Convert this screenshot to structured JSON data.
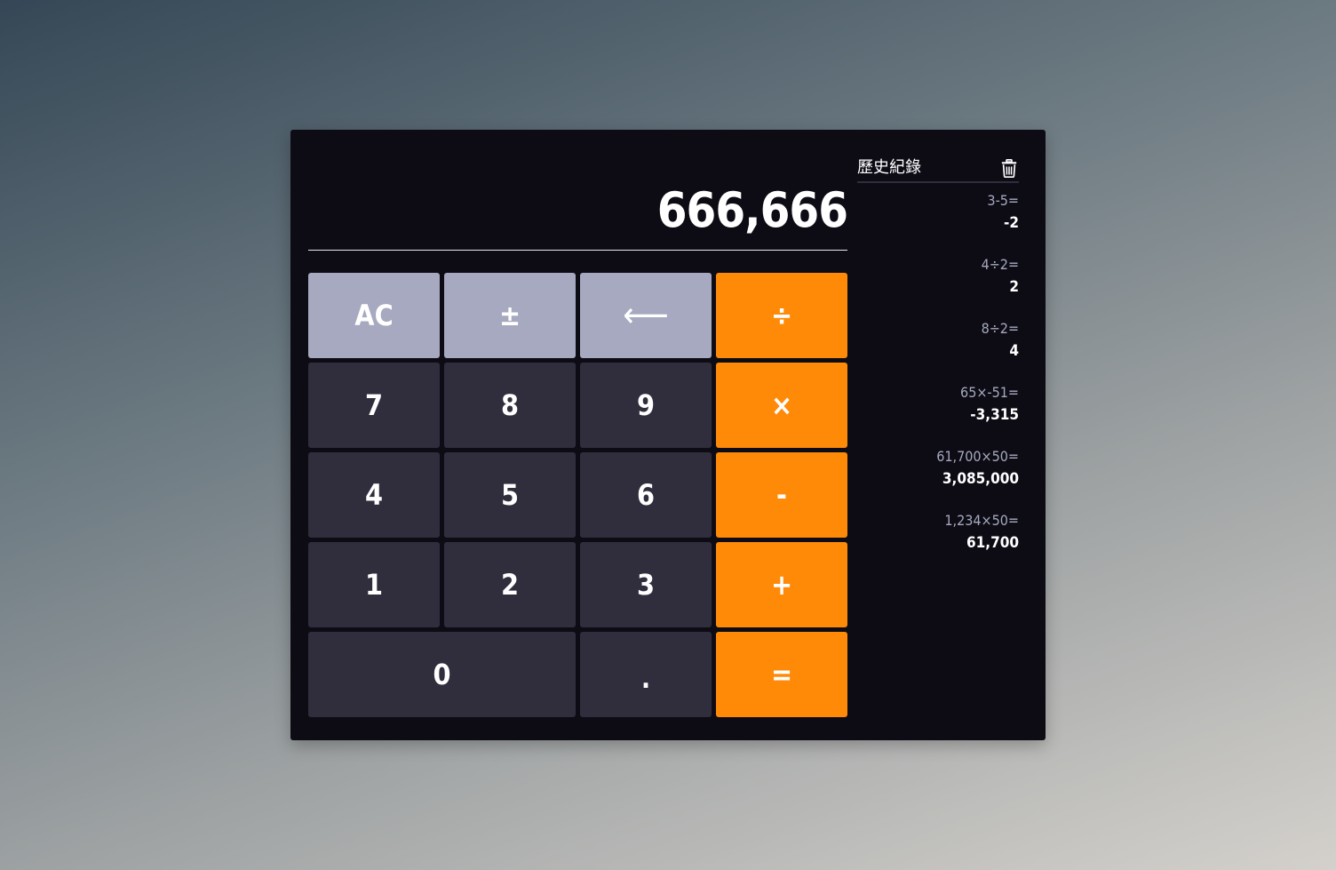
{
  "display": {
    "value": "666,666"
  },
  "keypad": {
    "ac": "AC",
    "plus_minus": "±",
    "backspace": "⟵",
    "divide": "÷",
    "seven": "7",
    "eight": "8",
    "nine": "9",
    "multiply": "×",
    "four": "4",
    "five": "5",
    "six": "6",
    "minus": "-",
    "one": "1",
    "two": "2",
    "three": "3",
    "plus": "+",
    "zero": "0",
    "decimal": ".",
    "equals": "="
  },
  "history": {
    "title": "歷史紀錄",
    "clear_icon": "trash-icon",
    "items": [
      {
        "expression": "3-5=",
        "result": "-2"
      },
      {
        "expression": "4÷2=",
        "result": "2"
      },
      {
        "expression": "8÷2=",
        "result": "4"
      },
      {
        "expression": "65×-51=",
        "result": "-3,315"
      },
      {
        "expression": "61,700×50=",
        "result": "3,085,000"
      },
      {
        "expression": "1,234×50=",
        "result": "61,700"
      }
    ]
  },
  "colors": {
    "panel": "#0d0c15",
    "function_key": "#a6a9bf",
    "number_key": "#302e3d",
    "operator_key": "#ff8a08",
    "history_expression": "#a6a9bf"
  }
}
